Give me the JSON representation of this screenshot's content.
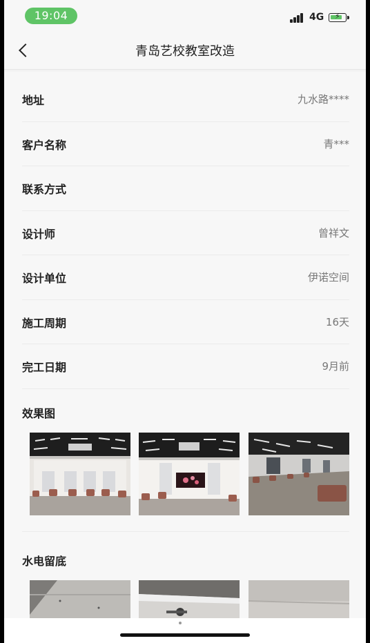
{
  "status_bar": {
    "time": "19:04",
    "network": "4G",
    "colors": {
      "time_pill": "#5fc466",
      "battery": "#5fc466"
    }
  },
  "nav": {
    "title": "青岛艺校教室改造",
    "back_icon": "chevron-left-icon"
  },
  "info": [
    {
      "label": "地址",
      "value": "九水路****"
    },
    {
      "label": "客户名称",
      "value": "青***"
    },
    {
      "label": "联系方式",
      "value": ""
    },
    {
      "label": "设计师",
      "value": "曾祥文"
    },
    {
      "label": "设计单位",
      "value": "伊诺空间"
    },
    {
      "label": "施工周期",
      "value": "16天"
    },
    {
      "label": "完工日期",
      "value": "9月前"
    }
  ],
  "sections": [
    {
      "title": "效果图",
      "images": [
        "rendering-classroom-1",
        "rendering-classroom-2",
        "rendering-classroom-3"
      ]
    },
    {
      "title": "水电留底",
      "images": [
        "site-photo-1",
        "site-photo-2",
        "site-photo-3"
      ]
    }
  ]
}
